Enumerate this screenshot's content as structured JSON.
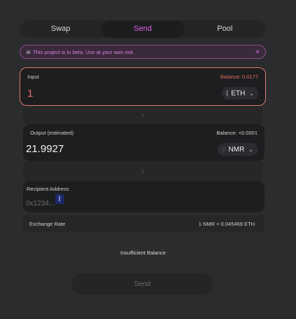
{
  "tabs": [
    {
      "label": "Swap"
    },
    {
      "label": "Send",
      "active": true
    },
    {
      "label": "Pool"
    }
  ],
  "beta_banner": {
    "icon": "skull-icon",
    "text": "This project is in beta. Use at your own risk.",
    "close": "×"
  },
  "input": {
    "label": "Input",
    "balance": "Balance: 0.0177",
    "amount": "1",
    "token": "ETH",
    "token_icon": "ethereum-icon"
  },
  "output": {
    "label": "Output (estimated)",
    "balance": "Balance: <0.0001",
    "amount": "21.9927",
    "token": "NMR",
    "token_icon": "numeraire-icon"
  },
  "recipient": {
    "label": "Recipient Address",
    "placeholder": "0x1234..."
  },
  "exchange_rate": {
    "label": "Exchange Rate",
    "value": "1 NMR = 0.045469 ETH"
  },
  "status": "Insufficient Balance",
  "send_button": "Send",
  "colors": {
    "accent": "#e25ce5",
    "error": "#ea6b62",
    "background": "#2b2c2e"
  }
}
